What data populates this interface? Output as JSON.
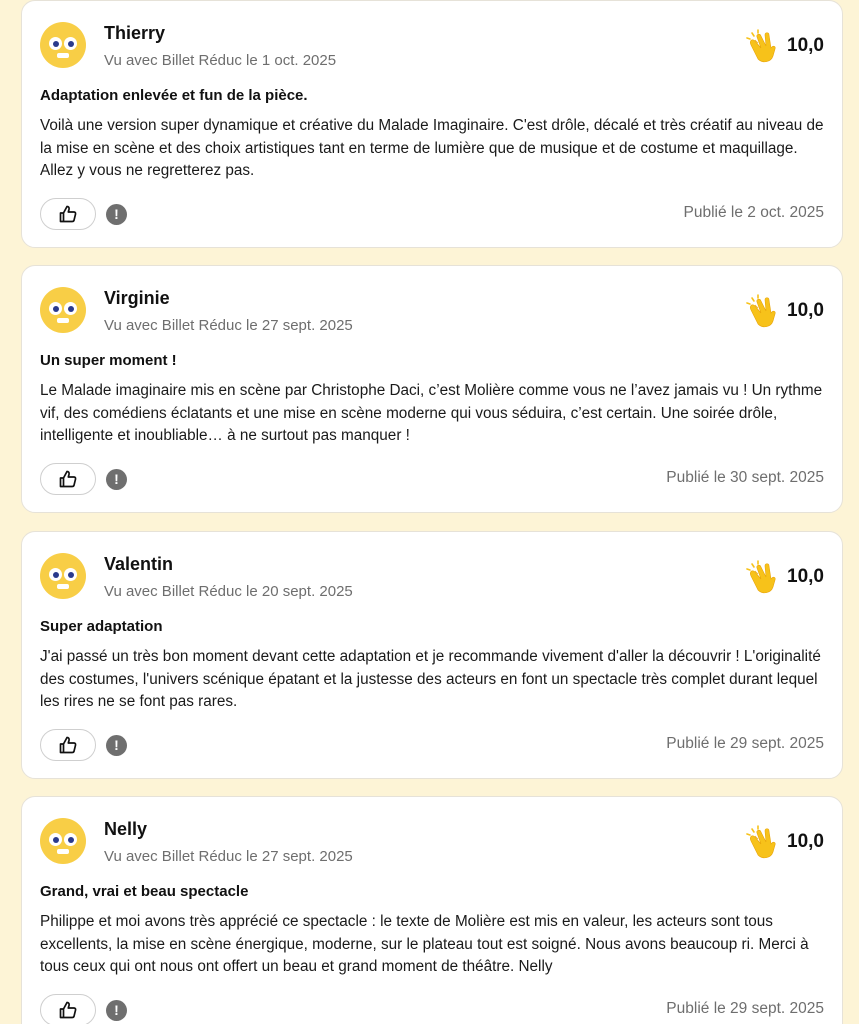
{
  "accent_color": "#f8ce46",
  "reviews": [
    {
      "name": "Thierry",
      "seen": "Vu avec Billet Réduc le 1 oct. 2025",
      "score": "10,0",
      "title": "Adaptation enlevée et fun de la pièce.",
      "body": "Voilà une version super dynamique et créative du Malade Imaginaire. C'est drôle, décalé et très créatif au niveau de la mise en scène et des choix artistiques tant en terme de lumière que de musique et de costume et maquillage. Allez y vous ne regretterez pas.",
      "published": "Publié le 2 oct. 2025",
      "report_glyph": "!",
      "like_icon": "thumbs-up-icon"
    },
    {
      "name": "Virginie",
      "seen": "Vu avec Billet Réduc le 27 sept. 2025",
      "score": "10,0",
      "title": "Un super moment !",
      "body": "Le Malade imaginaire mis en scène par Christophe Daci, c’est Molière comme vous ne l’avez jamais vu ! Un rythme vif, des comédiens éclatants et une mise en scène moderne qui vous séduira, c’est certain. Une soirée drôle, intelligente et inoubliable… à ne surtout pas manquer !",
      "published": "Publié le 30 sept. 2025",
      "report_glyph": "!",
      "like_icon": "thumbs-up-icon"
    },
    {
      "name": "Valentin",
      "seen": "Vu avec Billet Réduc le 20 sept. 2025",
      "score": "10,0",
      "title": "Super adaptation",
      "body": "J'ai passé un très bon moment devant cette adaptation et je recommande vivement d'aller la découvrir ! L'originalité des costumes, l'univers scénique épatant et la justesse des acteurs en font un spectacle très complet durant lequel les rires ne se font pas rares.",
      "published": "Publié le 29 sept. 2025",
      "report_glyph": "!",
      "like_icon": "thumbs-up-icon"
    },
    {
      "name": "Nelly",
      "seen": "Vu avec Billet Réduc le 27 sept. 2025",
      "score": "10,0",
      "title": "Grand, vrai et beau spectacle",
      "body": "Philippe et moi avons très apprécié ce spectacle : le texte de Molière est mis en valeur, les acteurs sont tous excellents, la mise en scène énergique, moderne, sur le plateau tout est soigné. Nous avons beaucoup ri. Merci à tous ceux qui ont nous ont offert un beau et grand moment de théâtre. Nelly",
      "published": "Publié le 29 sept. 2025",
      "report_glyph": "!",
      "like_icon": "thumbs-up-icon"
    }
  ]
}
